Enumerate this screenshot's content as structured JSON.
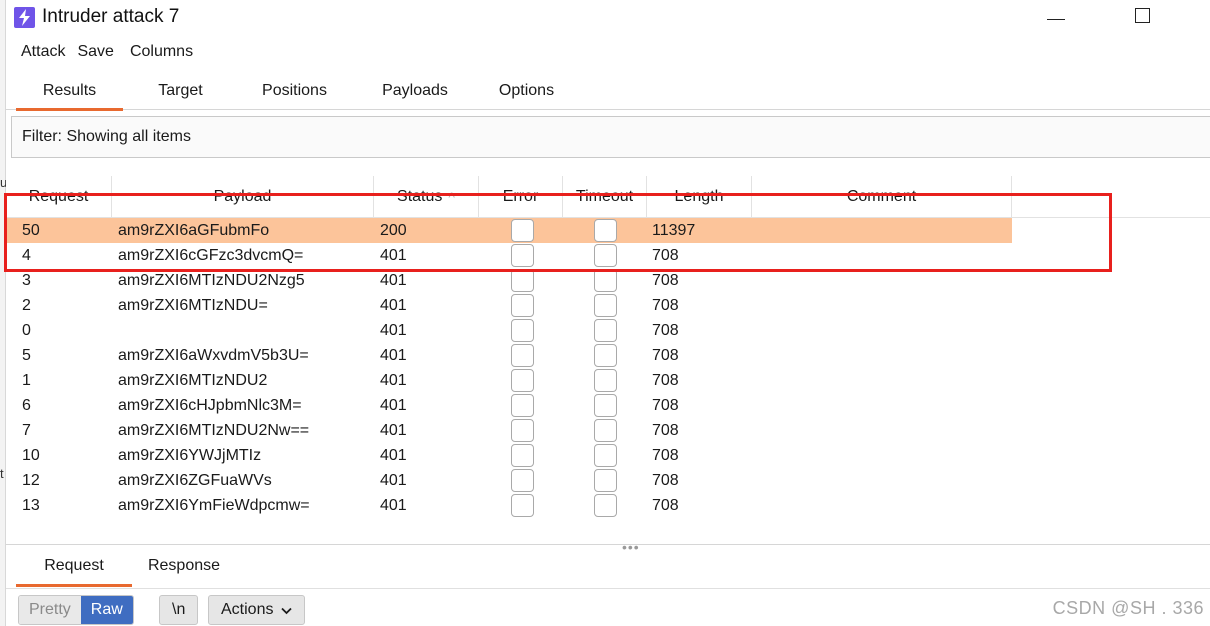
{
  "window": {
    "title": "Intruder attack 7"
  },
  "menu": [
    "Attack",
    "Save",
    "Columns"
  ],
  "tabs": [
    {
      "label": "Results",
      "active": true
    },
    {
      "label": "Target",
      "active": false
    },
    {
      "label": "Positions",
      "active": false
    },
    {
      "label": "Payloads",
      "active": false
    },
    {
      "label": "Options",
      "active": false
    }
  ],
  "filter": {
    "text": "Filter: Showing all items"
  },
  "table": {
    "columns": [
      "Request",
      "Payload",
      "Status",
      "Error",
      "Timeout",
      "Length",
      "Comment"
    ],
    "sort_indicator": "^",
    "rows": [
      {
        "request": "50",
        "payload": "am9rZXI6aGFubmFo",
        "status": "200",
        "length": "11397",
        "selected": true
      },
      {
        "request": "4",
        "payload": "am9rZXI6cGFzc3dvcmQ=",
        "status": "401",
        "length": "708",
        "selected": false
      },
      {
        "request": "3",
        "payload": "am9rZXI6MTIzNDU2Nzg5",
        "status": "401",
        "length": "708",
        "selected": false
      },
      {
        "request": "2",
        "payload": "am9rZXI6MTIzNDU=",
        "status": "401",
        "length": "708",
        "selected": false
      },
      {
        "request": "0",
        "payload": "",
        "status": "401",
        "length": "708",
        "selected": false
      },
      {
        "request": "5",
        "payload": "am9rZXI6aWxvdmV5b3U=",
        "status": "401",
        "length": "708",
        "selected": false
      },
      {
        "request": "1",
        "payload": "am9rZXI6MTIzNDU2",
        "status": "401",
        "length": "708",
        "selected": false
      },
      {
        "request": "6",
        "payload": "am9rZXI6cHJpbmNlc3M=",
        "status": "401",
        "length": "708",
        "selected": false
      },
      {
        "request": "7",
        "payload": "am9rZXI6MTIzNDU2Nw==",
        "status": "401",
        "length": "708",
        "selected": false
      },
      {
        "request": "10",
        "payload": "am9rZXI6YWJjMTIz",
        "status": "401",
        "length": "708",
        "selected": false
      },
      {
        "request": "12",
        "payload": "am9rZXI6ZGFuaWVs",
        "status": "401",
        "length": "708",
        "selected": false
      },
      {
        "request": "13",
        "payload": "am9rZXI6YmFieWdpcmw=",
        "status": "401",
        "length": "708",
        "selected": false
      }
    ]
  },
  "bottom_tabs": [
    {
      "label": "Request",
      "active": true
    },
    {
      "label": "Response",
      "active": false
    }
  ],
  "toolbar": {
    "pretty": "Pretty",
    "raw": "Raw",
    "newline": "\\n",
    "actions": "Actions"
  },
  "watermark": "CSDN @SH      . 336",
  "left_edge_fragments": [
    "u",
    "t"
  ],
  "colors": {
    "accent": "#e8692f",
    "selected_row": "#fcc49a",
    "highlight_box": "#e8201d",
    "raw_button": "#3f6dc1",
    "app_icon": "#6f54e8"
  }
}
